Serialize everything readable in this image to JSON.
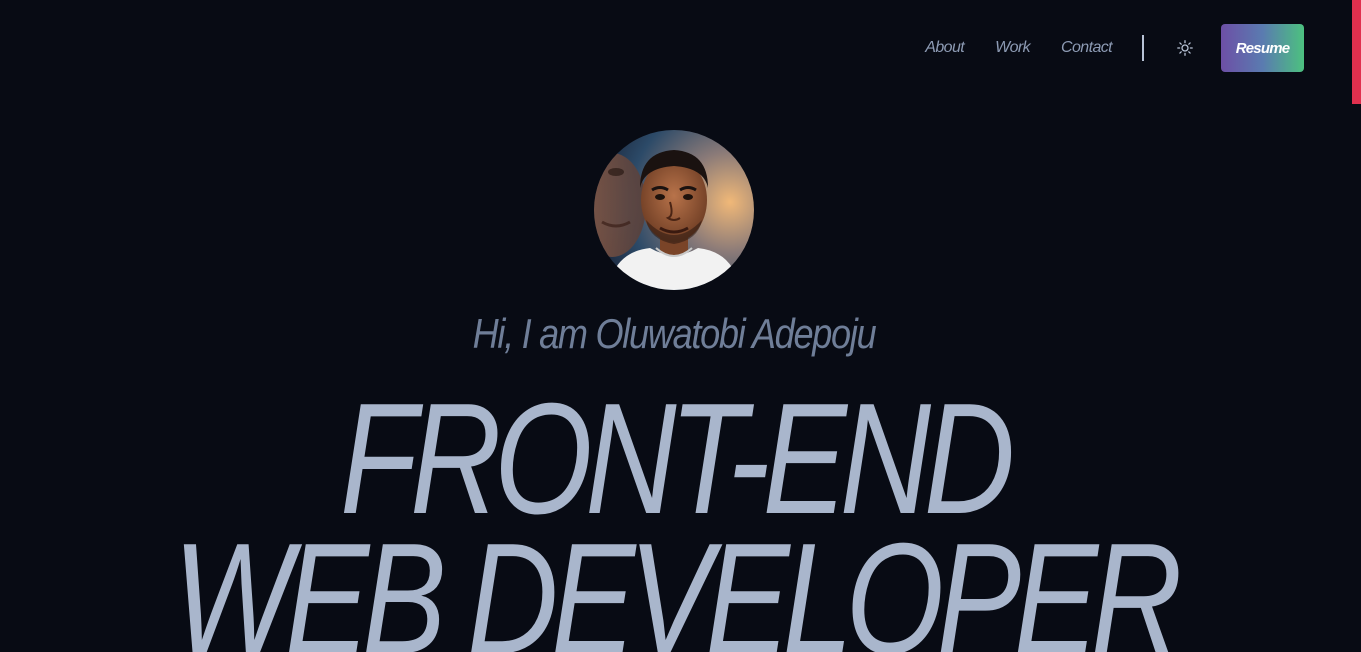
{
  "nav": {
    "links": [
      {
        "label": "About"
      },
      {
        "label": "Work"
      },
      {
        "label": "Contact"
      }
    ],
    "theme_toggle_icon": "sun-icon",
    "resume_label": "Resume"
  },
  "hero": {
    "avatar_icon": "profile-photo",
    "greeting": "Hi, I am Oluwatobi Adepoju",
    "headline_line1": "FRONT-END",
    "headline_line2": "WEB DEVELOPER"
  },
  "colors": {
    "background": "#080b14",
    "text": "#a9b6cc",
    "accent_bar": "#e0304e",
    "resume_gradient_start": "#6d4fa6",
    "resume_gradient_end": "#4cc17f"
  }
}
